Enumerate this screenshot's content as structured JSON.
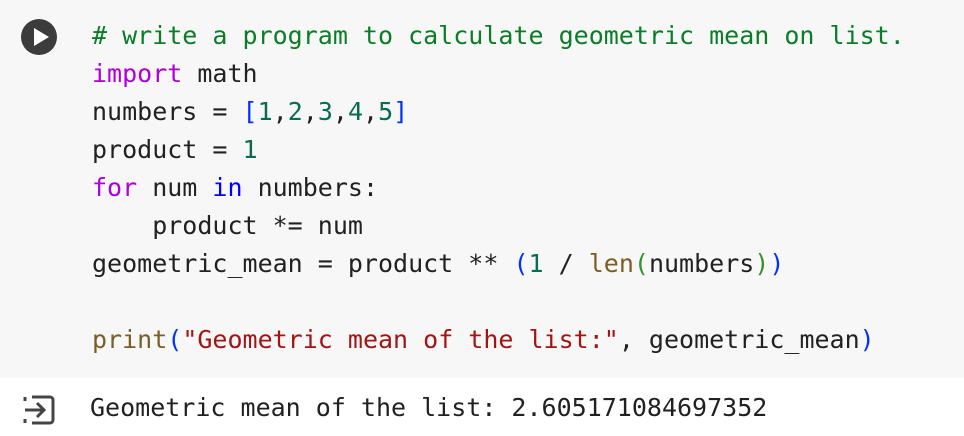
{
  "cell": {
    "run_button_icon": "play-circle-icon",
    "output_icon": "output-clear-icon",
    "code_lines": [
      [
        {
          "t": "# write a program to calculate geometric mean on list.",
          "c": "comment"
        }
      ],
      [
        {
          "t": "import",
          "c": "kw"
        },
        {
          "t": " math",
          "c": "var"
        }
      ],
      [
        {
          "t": "numbers = ",
          "c": "var"
        },
        {
          "t": "[",
          "c": "br1"
        },
        {
          "t": "1",
          "c": "num"
        },
        {
          "t": ",",
          "c": "var"
        },
        {
          "t": "2",
          "c": "num"
        },
        {
          "t": ",",
          "c": "var"
        },
        {
          "t": "3",
          "c": "num"
        },
        {
          "t": ",",
          "c": "var"
        },
        {
          "t": "4",
          "c": "num"
        },
        {
          "t": ",",
          "c": "var"
        },
        {
          "t": "5",
          "c": "num"
        },
        {
          "t": "]",
          "c": "br1"
        }
      ],
      [
        {
          "t": "product = ",
          "c": "var"
        },
        {
          "t": "1",
          "c": "num"
        }
      ],
      [
        {
          "t": "for",
          "c": "kw"
        },
        {
          "t": " num ",
          "c": "var"
        },
        {
          "t": "in",
          "c": "kw2"
        },
        {
          "t": " numbers:",
          "c": "var"
        }
      ],
      [
        {
          "t": "    product *= num",
          "c": "var"
        }
      ],
      [
        {
          "t": "geometric_mean = product ** ",
          "c": "var"
        },
        {
          "t": "(",
          "c": "br1"
        },
        {
          "t": "1",
          "c": "num"
        },
        {
          "t": " / ",
          "c": "var"
        },
        {
          "t": "len",
          "c": "fn"
        },
        {
          "t": "(",
          "c": "br2"
        },
        {
          "t": "numbers",
          "c": "var"
        },
        {
          "t": ")",
          "c": "br2"
        },
        {
          "t": ")",
          "c": "br1"
        }
      ],
      [
        {
          "t": "",
          "c": "var"
        }
      ],
      [
        {
          "t": "print",
          "c": "fn"
        },
        {
          "t": "(",
          "c": "br1"
        },
        {
          "t": "\"Geometric mean of the list:\"",
          "c": "str"
        },
        {
          "t": ", geometric_mean",
          "c": "var"
        },
        {
          "t": ")",
          "c": "br1"
        }
      ]
    ],
    "output_text": "Geometric mean of the list: 2.605171084697352"
  }
}
